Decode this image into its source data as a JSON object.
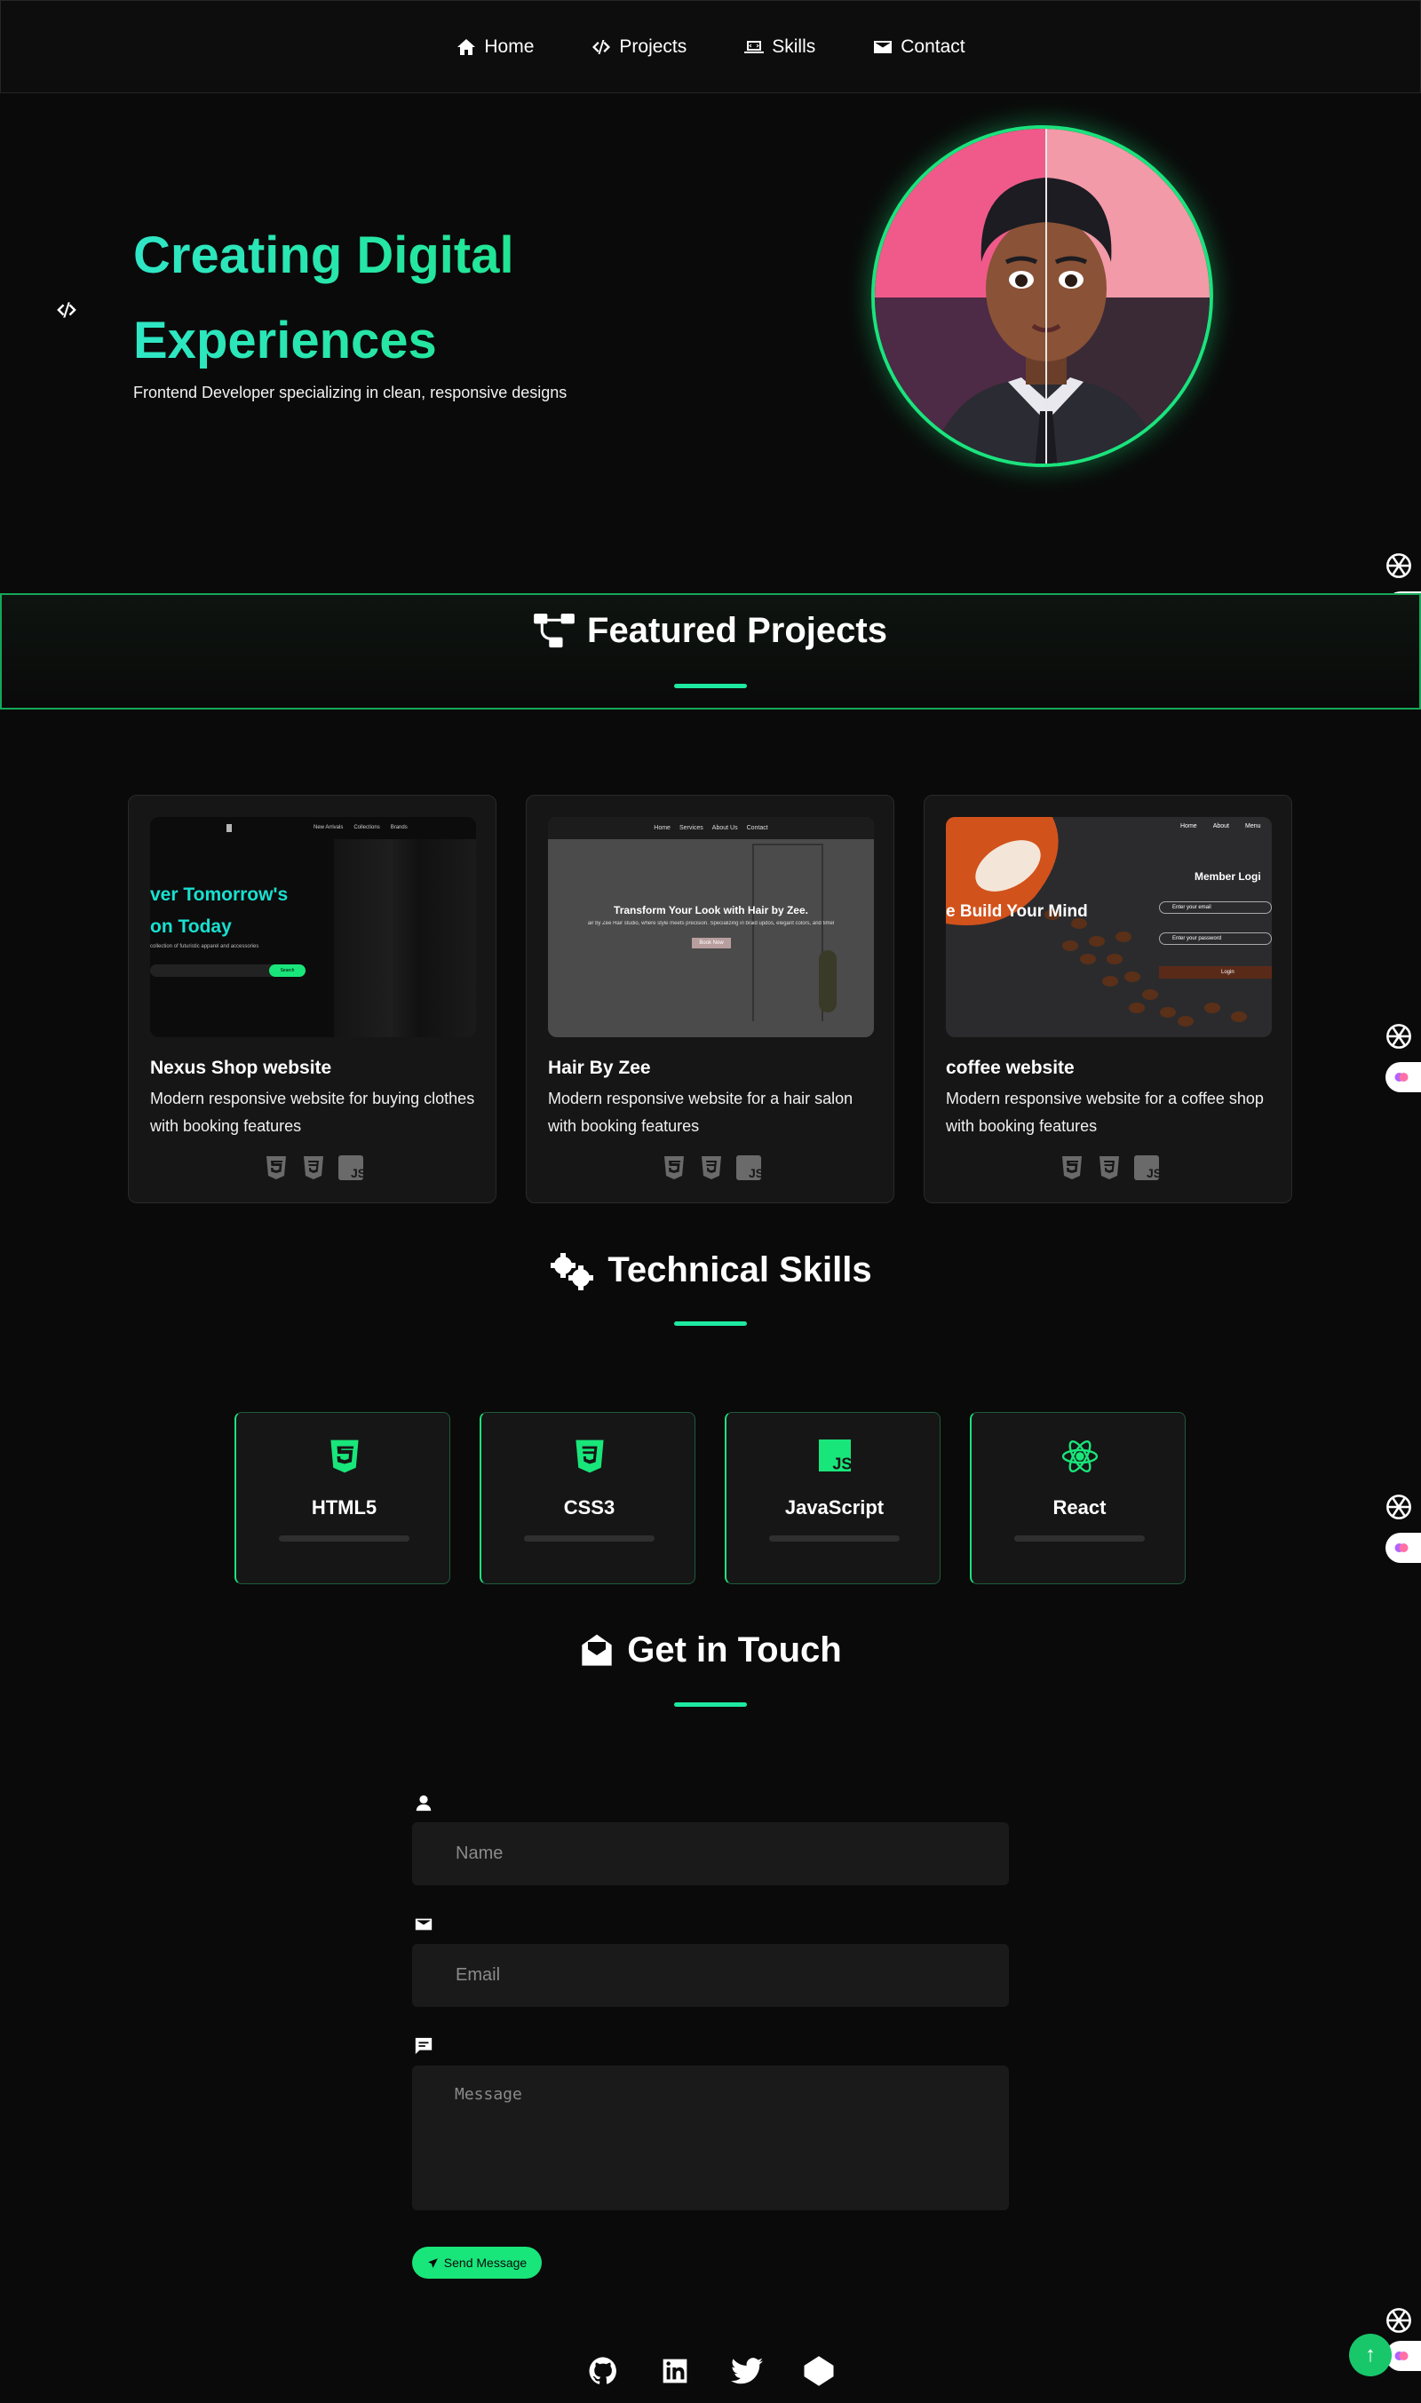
{
  "nav": {
    "items": [
      {
        "label": "Home",
        "icon": "home-icon"
      },
      {
        "label": "Projects",
        "icon": "code-icon"
      },
      {
        "label": "Skills",
        "icon": "laptop-code-icon"
      },
      {
        "label": "Contact",
        "icon": "envelope-icon"
      }
    ]
  },
  "hero": {
    "title_line1": "Creating Digital",
    "title_line2": "Experiences",
    "subtitle": "Frontend Developer specializing in clean, responsive designs"
  },
  "projects": {
    "title": "Featured Projects",
    "cards": [
      {
        "name": "Nexus Shop website",
        "description": "Modern responsive website for buying clothes with booking features",
        "shot": {
          "nav": [
            "New Arrivals",
            "Collections",
            "Brands"
          ],
          "headline1": "ver Tomorrow's",
          "headline2": "on Today",
          "tagline": "collection of futuristic apparel and accessories",
          "button": "Search"
        }
      },
      {
        "name": "Hair By Zee",
        "description": "Modern responsive website for a hair salon with booking features",
        "shot": {
          "nav": [
            "Home",
            "Services",
            "About Us",
            "Contact"
          ],
          "headline": "Transform Your Look with Hair by Zee.",
          "tagline": "air by Zee Hair studio, where style meets precision. Specializing in braid updos, elegant colors, and timel",
          "button": "Book Now"
        }
      },
      {
        "name": "coffee website",
        "description": "Modern responsive website for a coffee shop with booking features",
        "shot": {
          "nav": [
            "Home",
            "About",
            "Menu"
          ],
          "headline": "e Build Your Mind",
          "login_title": "Member Logi",
          "email_placeholder": "Enter your email",
          "password_placeholder": "Enter your password",
          "button": "Login"
        }
      }
    ],
    "tech": [
      "HTML5",
      "CSS3",
      "JS"
    ]
  },
  "skills": {
    "title": "Technical Skills",
    "items": [
      {
        "name": "HTML5",
        "icon": "html5-icon"
      },
      {
        "name": "CSS3",
        "icon": "css3-icon"
      },
      {
        "name": "JavaScript",
        "icon": "js-icon"
      },
      {
        "name": "React",
        "icon": "react-icon"
      }
    ]
  },
  "contact": {
    "title": "Get in Touch",
    "name_placeholder": "Name",
    "email_placeholder": "Email",
    "message_placeholder": "Message",
    "send_label": "Send Message"
  },
  "footer": {
    "socials": [
      "github-icon",
      "linkedin-icon",
      "twitter-icon",
      "codepen-icon"
    ]
  },
  "colors": {
    "accent": "#19e67a",
    "accent_teal": "#1de9b6",
    "background": "#0a0a0a",
    "card": "#161616"
  },
  "back_to_top": "↑"
}
